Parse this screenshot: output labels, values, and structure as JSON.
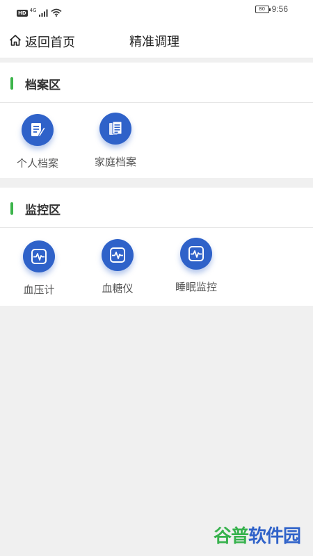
{
  "status_bar": {
    "hd": "HD",
    "network": "4G",
    "battery": "80",
    "time": "9:56"
  },
  "header": {
    "back_label": "返回首页",
    "title": "精准调理"
  },
  "archive_section": {
    "title": "档案区",
    "items": [
      {
        "label": "个人档案",
        "icon": "edit-document-icon"
      },
      {
        "label": "家庭档案",
        "icon": "documents-icon"
      }
    ]
  },
  "monitor_section": {
    "title": "监控区",
    "items": [
      {
        "label": "血压计",
        "icon": "pulse-monitor-icon"
      },
      {
        "label": "血糖仪",
        "icon": "pulse-monitor-icon"
      },
      {
        "label": "睡眠监控",
        "icon": "pulse-monitor-icon"
      }
    ]
  },
  "watermark": {
    "part1": "谷普",
    "part2": "软件园"
  },
  "colors": {
    "accent_green": "#3cb44b",
    "icon_blue": "#2f62c9",
    "background": "#f0f0f0"
  }
}
